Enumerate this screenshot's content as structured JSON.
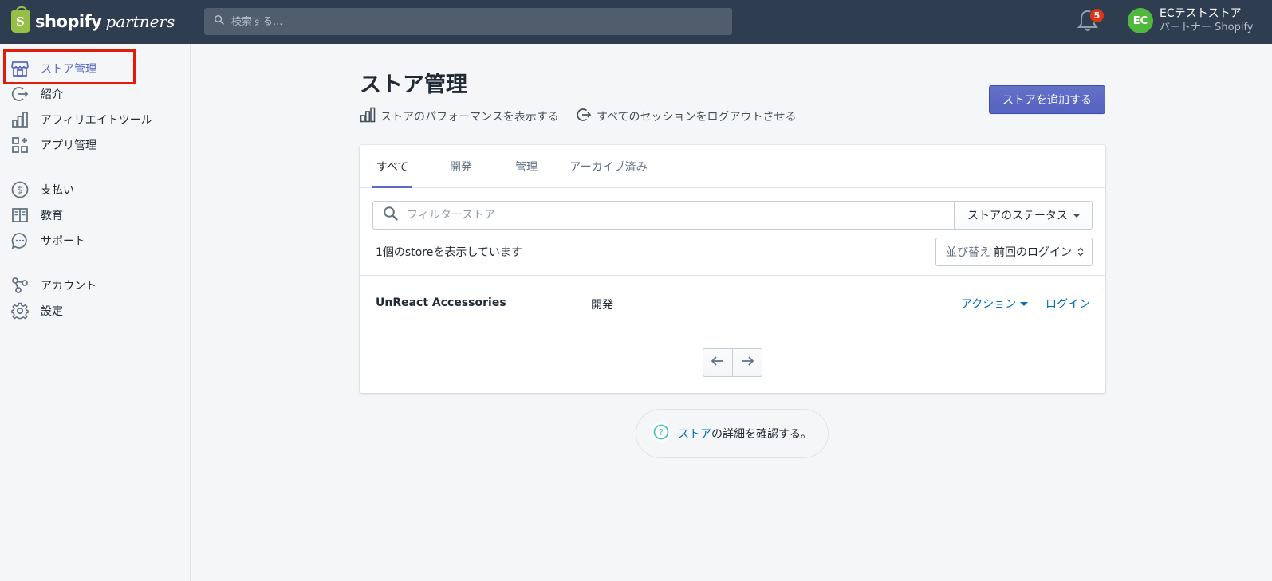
{
  "topbar": {
    "logo_text": "shopify",
    "logo_sub": "partners",
    "search_placeholder": "検索する...",
    "notification_count": "5",
    "user_initials": "EC",
    "user_name": "ECテストストア",
    "user_role": "パートナー Shopify"
  },
  "sidebar": {
    "items": [
      {
        "label": "ストア管理",
        "icon": "store-icon"
      },
      {
        "label": "紹介",
        "icon": "referral-icon"
      },
      {
        "label": "アフィリエイトツール",
        "icon": "bar-chart-icon"
      },
      {
        "label": "アプリ管理",
        "icon": "apps-icon"
      },
      {
        "label": "支払い",
        "icon": "dollar-icon"
      },
      {
        "label": "教育",
        "icon": "book-icon"
      },
      {
        "label": "サポート",
        "icon": "chat-icon"
      },
      {
        "label": "アカウント",
        "icon": "account-icon"
      },
      {
        "label": "設定",
        "icon": "gear-icon"
      }
    ]
  },
  "main": {
    "title": "ストア管理",
    "performance_link": "ストアのパフォーマンスを表示する",
    "logout_link": "すべてのセッションをログアウトさせる",
    "add_store_button": "ストアを追加する",
    "tabs": [
      "すべて",
      "開発",
      "管理",
      "アーカイブ済み"
    ],
    "filter_placeholder": "フィルターストア",
    "status_button": "ストアのステータス",
    "count_text": "1個のstoreを表示しています",
    "sort_label": "並び替え",
    "sort_value": "前回のログイン",
    "stores": [
      {
        "name": "UnReact Accessories",
        "type": "開発",
        "action": "アクション",
        "login": "ログイン"
      }
    ],
    "help_link": "ストア",
    "help_text": "の詳細を確認する。"
  },
  "colors": {
    "topbar": "#2e3d4f",
    "accent": "#5c6ac4",
    "link": "#006fbb",
    "badge": "#de3618",
    "avatar": "#50b83c",
    "highlight": "#e21b0c"
  }
}
